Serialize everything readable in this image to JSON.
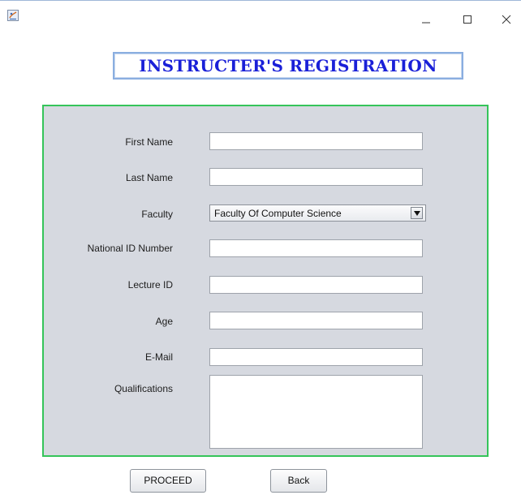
{
  "window": {
    "icon": "java-app-icon",
    "controls": {
      "minimize": "minimize-icon",
      "maximize": "maximize-icon",
      "close": "close-icon"
    }
  },
  "heading": {
    "text": "INSTRUCTER'S REGISTRATION",
    "color": "#1a20d8",
    "border_color": "#8aaee0"
  },
  "form": {
    "background": "#d6d9e0",
    "border_color": "#35c45a",
    "fields": {
      "first_name": {
        "label": "First Name",
        "value": ""
      },
      "last_name": {
        "label": "Last Name",
        "value": ""
      },
      "faculty": {
        "label": "Faculty",
        "selected": "Faculty Of Computer Science"
      },
      "national_id": {
        "label": "National ID Number",
        "value": ""
      },
      "lecture_id": {
        "label": "Lecture ID",
        "value": ""
      },
      "age": {
        "label": "Age",
        "value": ""
      },
      "email": {
        "label": "E-Mail",
        "value": ""
      },
      "qualifications": {
        "label": "Qualifications",
        "value": ""
      }
    }
  },
  "buttons": {
    "proceed": "PROCEED",
    "back": "Back"
  }
}
